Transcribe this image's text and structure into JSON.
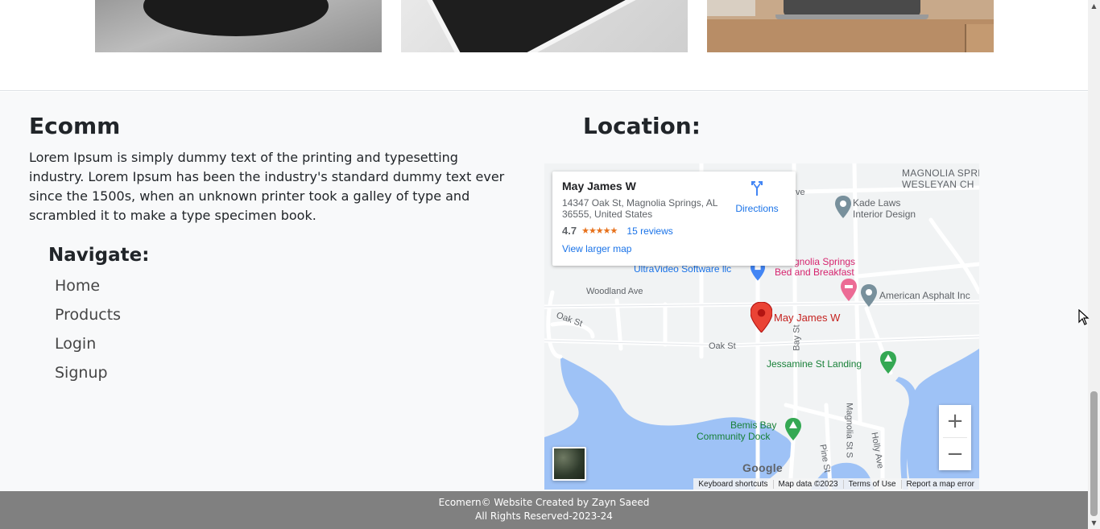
{
  "product_images": [
    "product-image-1",
    "product-image-2",
    "product-image-3"
  ],
  "footer": {
    "brand": "Ecomm",
    "description": "Lorem Ipsum is simply dummy text of the printing and typesetting industry. Lorem Ipsum has been the industry's standard dummy text ever since the 1500s, when an unknown printer took a galley of type and scrambled it to make a type specimen book.",
    "nav_title": "Navigate:",
    "nav": [
      "Home",
      "Products",
      "Login",
      "Signup"
    ],
    "location_title": "Location:"
  },
  "map": {
    "place_name": "May James W",
    "address": "14347 Oak St, Magnolia Springs, AL 36555, United States",
    "rating": "4.7",
    "stars": "★★★★★",
    "reviews": "15 reviews",
    "directions": "Directions",
    "view_larger": "View larger map",
    "labels": {
      "district": "MAGNOLIA SPRINGS",
      "district2": "WESLEYAN CH",
      "ave_fragment": "ve",
      "kade1": "Kade Laws",
      "kade2": "Interior Design",
      "ultravideo": "UltraVideo Software llc",
      "bnb1": "gnolia Springs",
      "bnb2": "Bed and Breakfast",
      "asphalt": "American Asphalt Inc",
      "woodland": "Woodland Ave",
      "oak_st_left": "Oak St",
      "oak_st": "Oak St",
      "bay_st": "Bay St",
      "marker": "May James W",
      "jessamine": "Jessamine St Landing",
      "bemis1": "Bemis Bay",
      "bemis2": "Community Dock",
      "magnolia_st": "Magnolia St S",
      "pine_st": "Pine St",
      "holly_ave": "Holly Ave"
    },
    "google": "Google",
    "attribution": [
      "Keyboard shortcuts",
      "Map data ©2023",
      "Terms of Use",
      "Report a map error"
    ],
    "zoom_in": "+",
    "zoom_out": "−"
  },
  "copyright": {
    "line1": "Ecomern© Website Created by Zayn Saeed",
    "line2": "All Rights Reserved-2023-24"
  },
  "colors": {
    "footer_bg": "#f8f9fa",
    "bottom_bar": "#808080",
    "link_blue": "#1a73e8",
    "water": "#9ec2f6"
  }
}
